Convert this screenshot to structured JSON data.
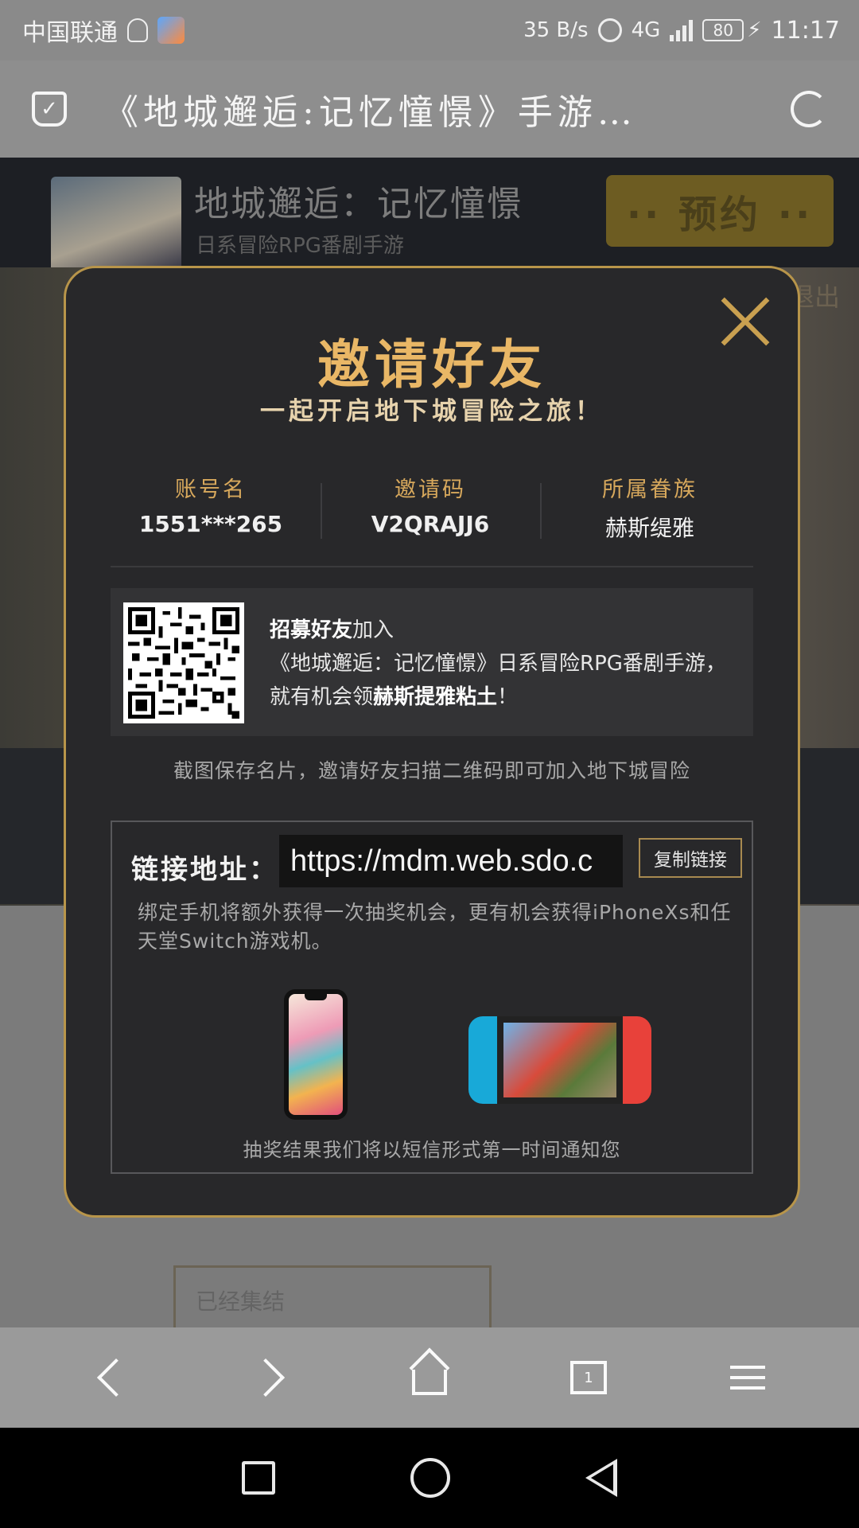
{
  "status_bar": {
    "carrier": "中国联通",
    "net_speed": "35 B/s",
    "net_type": "4G",
    "battery": "80",
    "time": "11:17"
  },
  "browser": {
    "page_title": "《地城邂逅:记忆憧憬》手游…"
  },
  "background": {
    "game_name": "地城邂逅：记忆憧憬",
    "game_tagline": "日系冒险RPG番剧手游",
    "reserve_label": "·· 预约 ··",
    "exit_label": "退出",
    "gathered_label": "已经集结"
  },
  "modal": {
    "title": "邀请好友",
    "subtitle": "一起开启地下城冒险之旅！",
    "info": [
      {
        "label": "账号名",
        "value": "1551***265"
      },
      {
        "label": "邀请码",
        "value": "V2QRAJJ6"
      },
      {
        "label": "所属眷族",
        "value": "赫斯缇雅"
      }
    ],
    "qr_text": {
      "line1_bold": "招募好友",
      "line1_rest": "加入",
      "line2": "《地城邂逅：记忆憧憬》日系冒险RPG番剧手游，",
      "line3_pre": "就有机会领",
      "line3_bold": "赫斯提雅粘土",
      "line3_post": "！"
    },
    "screenshot_tip": "截图保存名片，邀请好友扫描二维码即可加入地下城冒险",
    "link": {
      "label": "链接地址：",
      "value": "https://mdm.web.sdo.c",
      "copy_label": "复制链接"
    },
    "bind_tip": "绑定手机将额外获得一次抽奖机会，更有机会获得iPhoneXs和任天堂Switch游戏机。",
    "lottery_tip": "抽奖结果我们将以短信形式第一时间通知您"
  },
  "toolbar": {
    "tabs_count": "1"
  }
}
